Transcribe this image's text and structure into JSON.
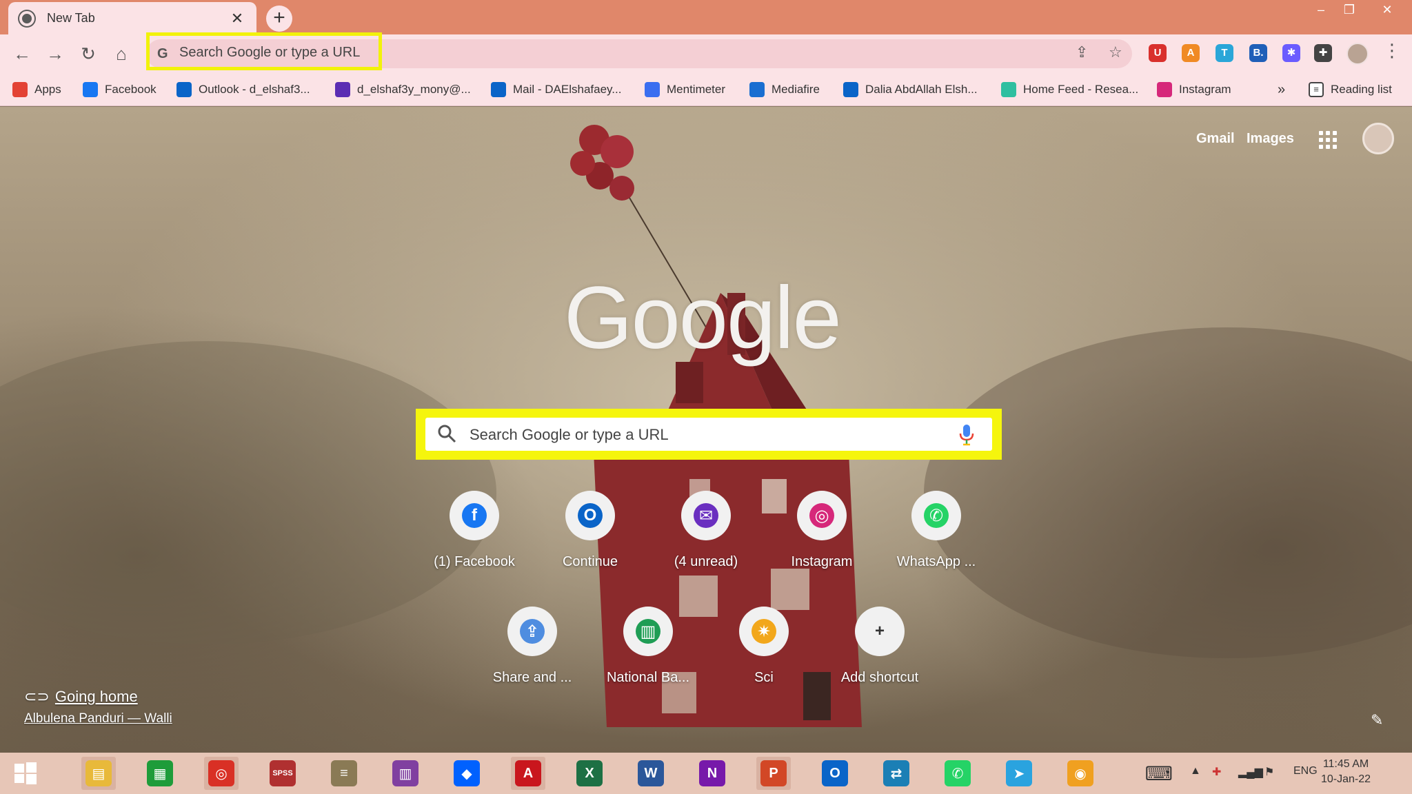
{
  "tab": {
    "title": "New Tab",
    "close": "✕",
    "new_tab": "+"
  },
  "window_controls": {
    "minimize": "–",
    "restore": "❐",
    "close": "✕"
  },
  "toolbar": {
    "back": "←",
    "forward": "→",
    "reload": "↻",
    "home": "⌂",
    "omnibox_text": "Search Google or type a URL",
    "share": "⇪",
    "star": "☆",
    "menu": "⋮"
  },
  "extensions": [
    {
      "name": "ublock-extension-icon",
      "label": "U",
      "color": "#d9302c"
    },
    {
      "name": "avast-extension-icon",
      "label": "A",
      "color": "#f08a24"
    },
    {
      "name": "translate-extension-icon",
      "label": "T",
      "color": "#2aa6d8"
    },
    {
      "name": "b-extension-icon",
      "label": "B.",
      "color": "#1f5fb8"
    },
    {
      "name": "snowflake-extension-icon",
      "label": "✱",
      "color": "#6a5cff"
    },
    {
      "name": "puzzle-extensions-icon",
      "label": "✚",
      "color": "#444444"
    }
  ],
  "bookmarks": {
    "items": [
      {
        "label": "Apps",
        "icon": "apps-grid-icon",
        "color": "#e34234"
      },
      {
        "label": "Facebook",
        "icon": "facebook-icon",
        "color": "#1877f2"
      },
      {
        "label": "Outlook - d_elshaf3...",
        "icon": "outlook-icon",
        "color": "#0a64c8"
      },
      {
        "label": "d_elshaf3y_mony@...",
        "icon": "mail-icon",
        "color": "#5b2db3"
      },
      {
        "label": "Mail - DAElshafaey...",
        "icon": "outlook-icon",
        "color": "#0a64c8"
      },
      {
        "label": "Mentimeter",
        "icon": "mentimeter-icon",
        "color": "#3a6ef0"
      },
      {
        "label": "Mediafire",
        "icon": "mediafire-icon",
        "color": "#1a6ed1"
      },
      {
        "label": "Dalia AbdAllah Elsh...",
        "icon": "outlook-icon",
        "color": "#0a64c8"
      },
      {
        "label": "Home Feed - Resea...",
        "icon": "researchgate-icon",
        "color": "#2fbfa0"
      },
      {
        "label": "Instagram",
        "icon": "instagram-icon",
        "color": "#d6287a"
      }
    ],
    "overflow": "»",
    "reading_list": "Reading list"
  },
  "ntp": {
    "gmail": "Gmail",
    "images": "Images",
    "logo": "Google",
    "search_placeholder": "Search Google or type a URL",
    "shortcuts_row1": [
      {
        "label": "(1) Facebook",
        "icon": "facebook-icon",
        "color": "#1877f2"
      },
      {
        "label": "Continue",
        "icon": "outlook-icon",
        "color": "#0a64c8"
      },
      {
        "label": "(4 unread)",
        "icon": "mail-icon",
        "color": "#6a2fc0"
      },
      {
        "label": "Instagram",
        "icon": "instagram-icon",
        "color": "#d6287a"
      },
      {
        "label": "WhatsApp ...",
        "icon": "whatsapp-icon",
        "color": "#25d366"
      }
    ],
    "shortcuts_row2": [
      {
        "label": "Share and ...",
        "icon": "share-app-icon",
        "color": "#4f8de0"
      },
      {
        "label": "National Ba...",
        "icon": "national-bank-icon",
        "color": "#1f9d55"
      },
      {
        "label": "Sci",
        "icon": "sci-icon",
        "color": "#f2a71b"
      },
      {
        "label": "Add shortcut",
        "icon": "plus-icon",
        "color": "#333333"
      }
    ],
    "attribution_title": "Going home",
    "attribution_author": "Albulena Panduri — Walli"
  },
  "taskbar": {
    "apps": [
      {
        "name": "file-explorer-icon",
        "label": "▤",
        "color": "#e8b93a"
      },
      {
        "name": "store-icon",
        "label": "▦",
        "color": "#1e9c3a"
      },
      {
        "name": "chrome-icon",
        "label": "◎",
        "color": "#d93025"
      },
      {
        "name": "spss-icon",
        "label": "SPSS",
        "color": "#b03030"
      },
      {
        "name": "books-icon",
        "label": "≡",
        "color": "#8a7a55"
      },
      {
        "name": "winrar-icon",
        "label": "▥",
        "color": "#8040a0"
      },
      {
        "name": "dropbox-icon",
        "label": "◆",
        "color": "#0061fe"
      },
      {
        "name": "acrobat-icon",
        "label": "A",
        "color": "#c9161d"
      },
      {
        "name": "excel-icon",
        "label": "X",
        "color": "#1d7044"
      },
      {
        "name": "word-icon",
        "label": "W",
        "color": "#2b579a"
      },
      {
        "name": "onenote-icon",
        "label": "N",
        "color": "#7719aa"
      },
      {
        "name": "powerpoint-icon",
        "label": "P",
        "color": "#d24726"
      },
      {
        "name": "outlook-icon",
        "label": "O",
        "color": "#0a64c8"
      },
      {
        "name": "mail-transfer-icon",
        "label": "⇄",
        "color": "#1b7fb5"
      },
      {
        "name": "whatsapp-icon",
        "label": "✆",
        "color": "#25d366"
      },
      {
        "name": "telegram-icon",
        "label": "➤",
        "color": "#2aa3df"
      },
      {
        "name": "vpn-icon",
        "label": "◉",
        "color": "#f0a020"
      }
    ],
    "language": "ENG",
    "time": "11:45 AM",
    "date": "10-Jan-22"
  }
}
